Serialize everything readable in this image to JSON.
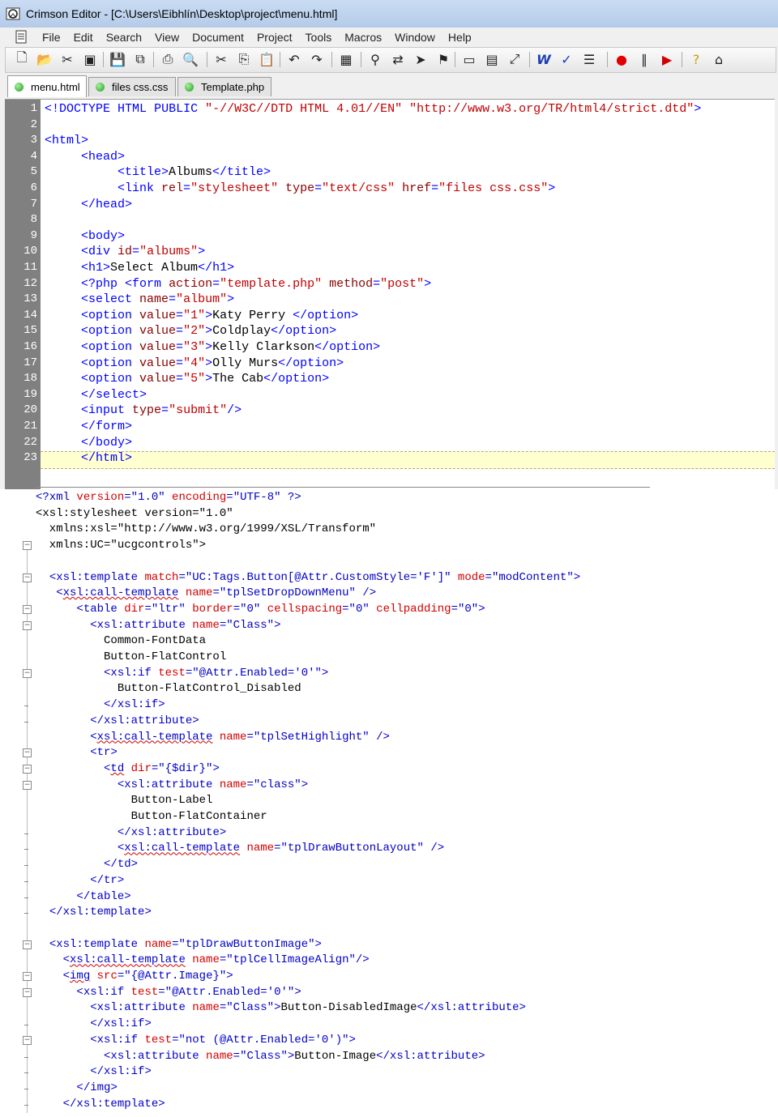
{
  "window": {
    "title": "Crimson Editor - [C:\\Users\\Eibhlín\\Desktop\\project\\menu.html]"
  },
  "menu": [
    "File",
    "Edit",
    "Search",
    "View",
    "Document",
    "Project",
    "Tools",
    "Macros",
    "Window",
    "Help"
  ],
  "toolbar_icons": [
    "new-file-icon",
    "open-folder-icon",
    "cut-icon",
    "open-icon",
    "save-icon",
    "save-all-icon",
    "print-icon",
    "print-preview-icon",
    "scissors-icon",
    "copy-icon",
    "paste-icon",
    "undo-icon",
    "redo-icon",
    "column-mode-icon",
    "find-icon",
    "replace-icon",
    "goto-icon",
    "bookmark-icon",
    "window-icon",
    "tile-icon",
    "fullscreen-icon",
    "word-wrap-icon",
    "spell-check-icon",
    "line-numbers-icon",
    "record-macro-icon",
    "pause-icon",
    "play-icon",
    "help-icon",
    "home-icon"
  ],
  "tabs": [
    {
      "label": "menu.html",
      "active": true
    },
    {
      "label": "files css.css",
      "active": false
    },
    {
      "label": "Template.php",
      "active": false
    }
  ],
  "code": {
    "line_numbers": [
      "1",
      "2",
      "3",
      "4",
      "5",
      "6",
      "7",
      "8",
      "9",
      "10",
      "11",
      "12",
      "13",
      "14",
      "15",
      "16",
      "17",
      "18",
      "19",
      "20",
      "21",
      "22",
      "23"
    ],
    "lines": [
      "<!DOCTYPE HTML PUBLIC \"-//W3C//DTD HTML 4.01//EN\" \"http://www.w3.org/TR/html4/strict.dtd\">",
      "",
      "<html>",
      "     <head>",
      "          <title>Albums</title>",
      "          <link rel=\"stylesheet\" type=\"text/css\" href=\"files css.css\">",
      "     </head>",
      "",
      "     <body>",
      "     <div id=\"albums\">",
      "     <h1>Select Album</h1>",
      "     <?php <form action=\"template.php\" method=\"post\">",
      "     <select name=\"album\">",
      "     <option value=\"1\">Katy Perry </option>",
      "     <option value=\"2\">Coldplay</option>",
      "     <option value=\"3\">Kelly Clarkson</option>",
      "     <option value=\"4\">Olly Murs</option>",
      "     <option value=\"5\">The Cab</option>",
      "     </select>",
      "     <input type=\"submit\"/>",
      "     </form>",
      "     </body>",
      "     </html>"
    ],
    "current_line": "23"
  },
  "xsl": {
    "lines": [
      "<?xml version=\"1.0\" encoding=\"UTF-8\" ?>",
      "<xsl:stylesheet version=\"1.0\"",
      "  xmlns:xsl=\"http://www.w3.org/1999/XSL/Transform\"",
      "  xmlns:UC=\"ucgcontrols\">",
      "",
      "  <xsl:template match=\"UC:Tags.Button[@Attr.CustomStyle='F']\" mode=\"modContent\">",
      "   <xsl:call-template name=\"tplSetDropDownMenu\" />",
      "      <table dir=\"ltr\" border=\"0\" cellspacing=\"0\" cellpadding=\"0\">",
      "        <xsl:attribute name=\"Class\">",
      "          Common-FontData",
      "          Button-FlatControl",
      "          <xsl:if test=\"@Attr.Enabled='0'\">",
      "            Button-FlatControl_Disabled",
      "          </xsl:if>",
      "        </xsl:attribute>",
      "        <xsl:call-template name=\"tplSetHighlight\" />",
      "        <tr>",
      "          <td dir=\"{$dir}\">",
      "            <xsl:attribute name=\"class\">",
      "              Button-Label",
      "              Button-FlatContainer",
      "            </xsl:attribute>",
      "            <xsl:call-template name=\"tplDrawButtonLayout\" />",
      "          </td>",
      "        </tr>",
      "      </table>",
      "  </xsl:template>",
      "",
      "  <xsl:template name=\"tplDrawButtonImage\">",
      "    <xsl:call-template name=\"tplCellImageAlign\"/>",
      "    <img src=\"{@Attr.Image}\">",
      "      <xsl:if test=\"@Attr.Enabled='0'\">",
      "        <xsl:attribute name=\"Class\">Button-DisabledImage</xsl:attribute>",
      "        </xsl:if>",
      "        <xsl:if test=\"not (@Attr.Enabled='0')\">",
      "          <xsl:attribute name=\"Class\">Button-Image</xsl:attribute>",
      "        </xsl:if>",
      "      </img>",
      "    </xsl:template>"
    ]
  },
  "colors": {
    "keyword": "#0000ff",
    "gutter": "#808080",
    "current_line": "#ffffd0"
  }
}
